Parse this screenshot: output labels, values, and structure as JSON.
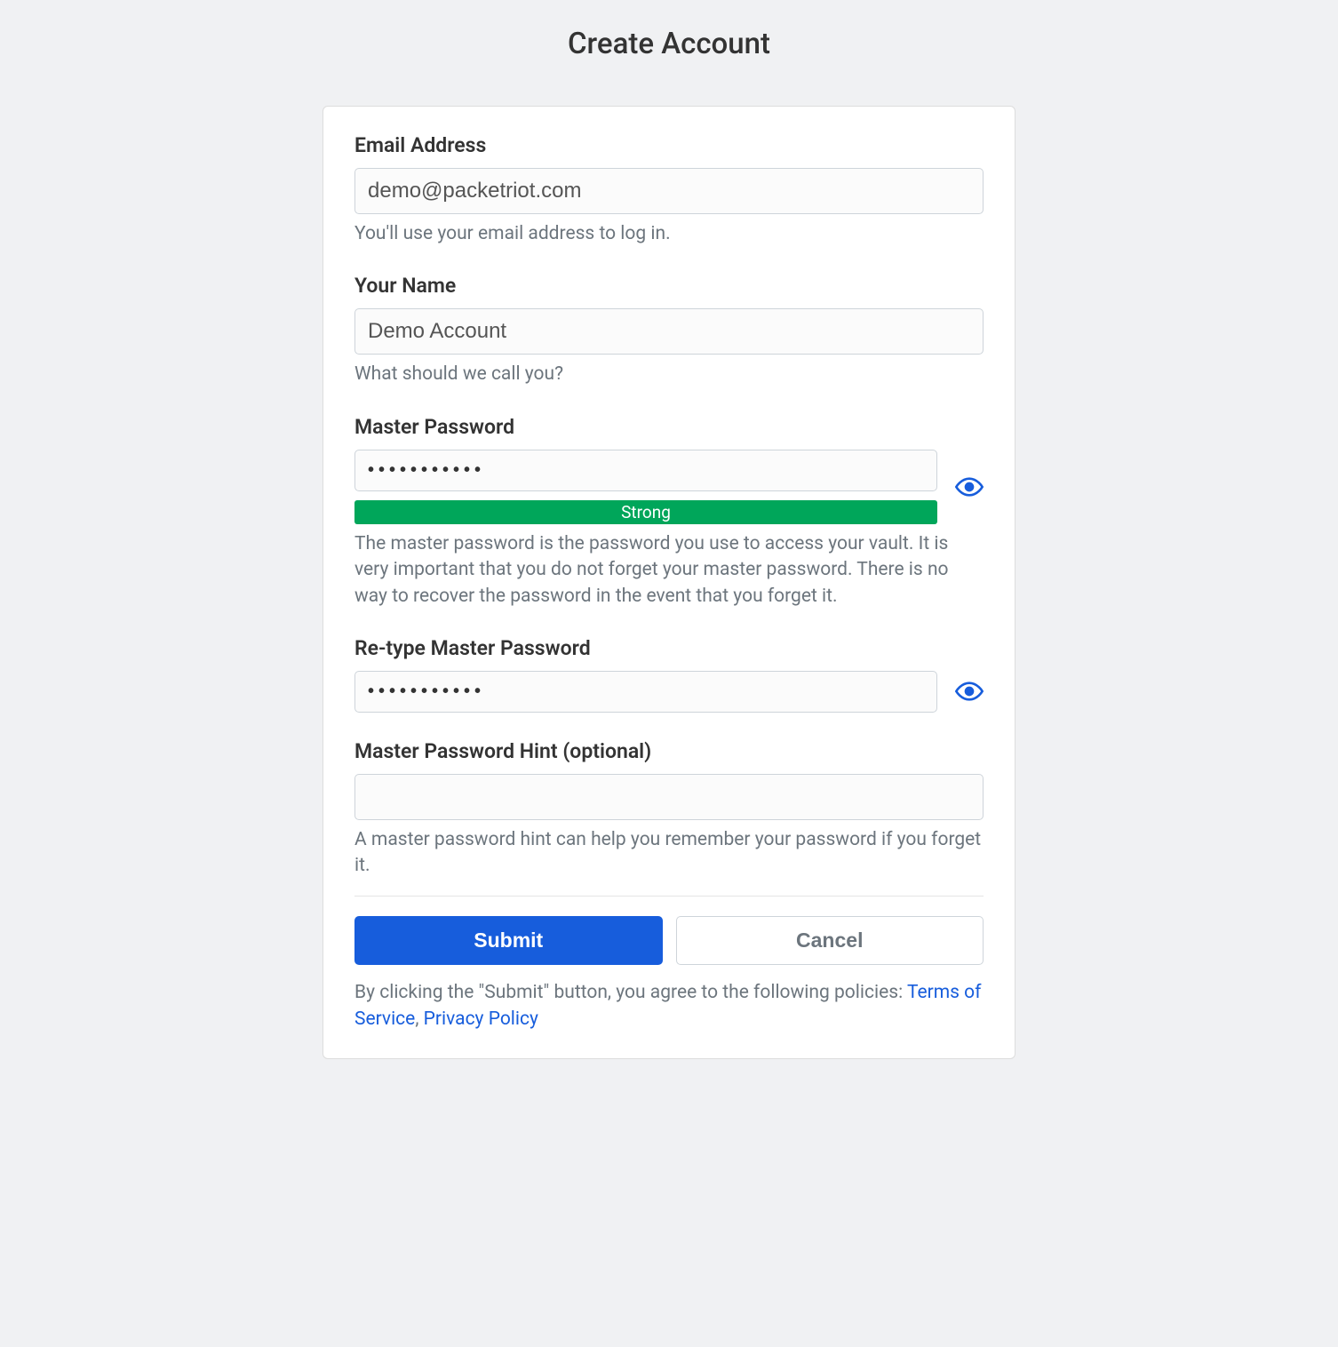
{
  "page": {
    "title": "Create Account"
  },
  "form": {
    "email": {
      "label": "Email Address",
      "value": "demo@packetriot.com",
      "hint": "You'll use your email address to log in."
    },
    "name": {
      "label": "Your Name",
      "value": "Demo Account",
      "hint": "What should we call you?"
    },
    "master_password": {
      "label": "Master Password",
      "value": "•••••••••••",
      "strength": "Strong",
      "hint": "The master password is the password you use to access your vault. It is very important that you do not forget your master password. There is no way to recover the password in the event that you forget it."
    },
    "retype_password": {
      "label": "Re-type Master Password",
      "value": "•••••••••••"
    },
    "hint": {
      "label": "Master Password Hint (optional)",
      "value": "",
      "hint": "A master password hint can help you remember your password if you forget it."
    }
  },
  "buttons": {
    "submit": "Submit",
    "cancel": "Cancel"
  },
  "footer": {
    "text_before": "By clicking the \"Submit\" button, you agree to the following policies: ",
    "terms_link": "Terms of Service",
    "separator": ", ",
    "privacy_link": "Privacy Policy"
  },
  "colors": {
    "primary": "#175ddc",
    "success": "#00a65a",
    "background": "#f0f1f3"
  }
}
